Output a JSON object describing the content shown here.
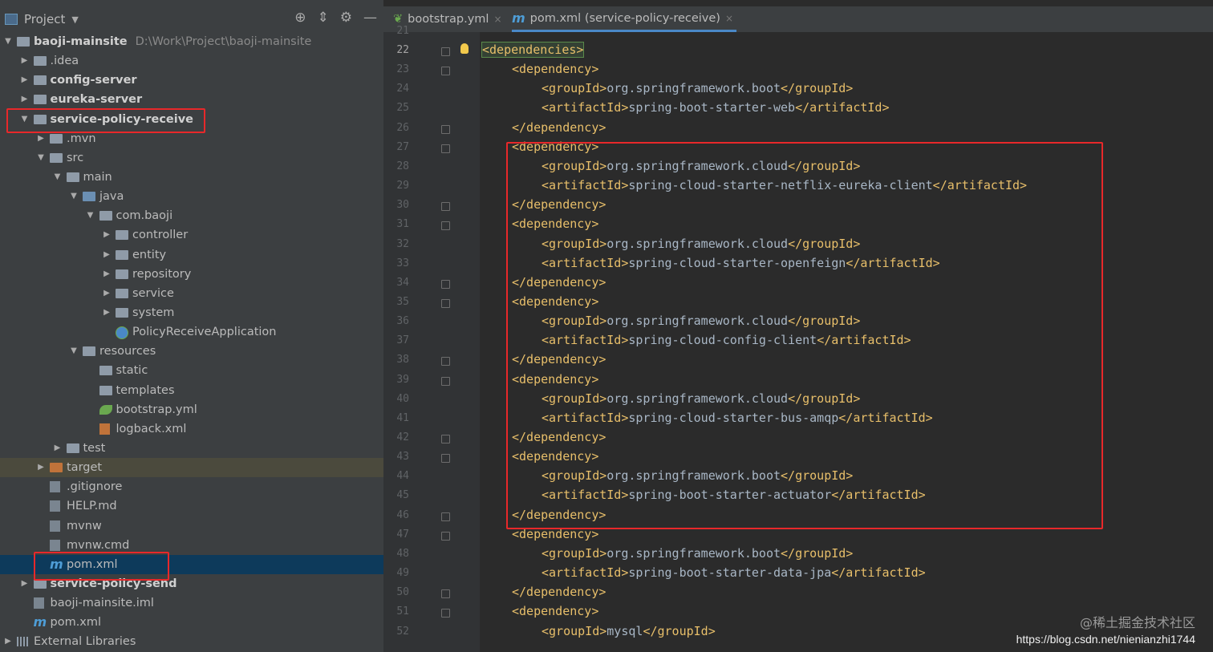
{
  "project_pane": {
    "title": "Project",
    "tool_icons": [
      "globe-icon",
      "collapse-icon",
      "gear-icon",
      "minimize-icon"
    ]
  },
  "tree": [
    {
      "label": "baoji-mainsite",
      "path": "D:\\Work\\Project\\baoji-mainsite",
      "depth": 0,
      "arrow": "down",
      "icon": "folder",
      "bold": true
    },
    {
      "label": ".idea",
      "depth": 1,
      "arrow": "right",
      "icon": "folder"
    },
    {
      "label": "config-server",
      "depth": 1,
      "arrow": "right",
      "icon": "folder",
      "bold": true
    },
    {
      "label": "eureka-server",
      "depth": 1,
      "arrow": "right",
      "icon": "folder",
      "bold": true
    },
    {
      "label": "service-policy-receive",
      "depth": 1,
      "arrow": "down",
      "icon": "folder",
      "bold": true
    },
    {
      "label": ".mvn",
      "depth": 2,
      "arrow": "right",
      "icon": "folder"
    },
    {
      "label": "src",
      "depth": 2,
      "arrow": "down",
      "icon": "folder"
    },
    {
      "label": "main",
      "depth": 3,
      "arrow": "down",
      "icon": "folder"
    },
    {
      "label": "java",
      "depth": 4,
      "arrow": "down",
      "icon": "folder-blue"
    },
    {
      "label": "com.baoji",
      "depth": 5,
      "arrow": "down",
      "icon": "folder"
    },
    {
      "label": "controller",
      "depth": 6,
      "arrow": "right",
      "icon": "folder"
    },
    {
      "label": "entity",
      "depth": 6,
      "arrow": "right",
      "icon": "folder"
    },
    {
      "label": "repository",
      "depth": 6,
      "arrow": "right",
      "icon": "folder"
    },
    {
      "label": "service",
      "depth": 6,
      "arrow": "right",
      "icon": "folder"
    },
    {
      "label": "system",
      "depth": 6,
      "arrow": "right",
      "icon": "folder"
    },
    {
      "label": "PolicyReceiveApplication",
      "depth": 6,
      "arrow": "",
      "icon": "spring-class"
    },
    {
      "label": "resources",
      "depth": 4,
      "arrow": "down",
      "icon": "folder"
    },
    {
      "label": "static",
      "depth": 5,
      "arrow": "",
      "icon": "folder"
    },
    {
      "label": "templates",
      "depth": 5,
      "arrow": "",
      "icon": "folder"
    },
    {
      "label": "bootstrap.yml",
      "depth": 5,
      "arrow": "",
      "icon": "yml-leaf"
    },
    {
      "label": "logback.xml",
      "depth": 5,
      "arrow": "",
      "icon": "xml-file"
    },
    {
      "label": "test",
      "depth": 3,
      "arrow": "right",
      "icon": "folder"
    },
    {
      "label": "target",
      "depth": 2,
      "arrow": "right",
      "icon": "folder-orange",
      "highlight": "olive"
    },
    {
      "label": ".gitignore",
      "depth": 2,
      "arrow": "",
      "icon": "file"
    },
    {
      "label": "HELP.md",
      "depth": 2,
      "arrow": "",
      "icon": "md-file"
    },
    {
      "label": "mvnw",
      "depth": 2,
      "arrow": "",
      "icon": "file"
    },
    {
      "label": "mvnw.cmd",
      "depth": 2,
      "arrow": "",
      "icon": "file"
    },
    {
      "label": "pom.xml",
      "depth": 2,
      "arrow": "",
      "icon": "maven",
      "highlight": "selected"
    },
    {
      "label": "service-policy-send",
      "depth": 1,
      "arrow": "right",
      "icon": "folder",
      "bold": true
    },
    {
      "label": "baoji-mainsite.iml",
      "depth": 1,
      "arrow": "",
      "icon": "file"
    },
    {
      "label": "pom.xml",
      "depth": 1,
      "arrow": "",
      "icon": "maven"
    },
    {
      "label": "External Libraries",
      "depth": 0,
      "arrow": "right",
      "icon": "library"
    }
  ],
  "tabs": [
    {
      "label": "bootstrap.yml",
      "icon": "yml-leaf",
      "active": false
    },
    {
      "label": "pom.xml (service-policy-receive)",
      "icon": "maven",
      "active": true
    }
  ],
  "editor": {
    "first_partial_line": "21",
    "lines": [
      {
        "n": "22",
        "indent": 0,
        "parts": [
          {
            "t": "<dependencies>"
          }
        ],
        "current": true,
        "fold": "open",
        "bulb": true
      },
      {
        "n": "23",
        "indent": 1,
        "parts": [
          {
            "t": "<dependency>"
          }
        ],
        "fold": "open"
      },
      {
        "n": "24",
        "indent": 2,
        "parts": [
          {
            "t": "<groupId>"
          },
          {
            "v": "org.springframework.boot"
          },
          {
            "t": "</groupId>"
          }
        ]
      },
      {
        "n": "25",
        "indent": 2,
        "parts": [
          {
            "t": "<artifactId>"
          },
          {
            "v": "spring-boot-starter-web"
          },
          {
            "t": "</artifactId>"
          }
        ]
      },
      {
        "n": "26",
        "indent": 1,
        "parts": [
          {
            "t": "</dependency>"
          }
        ],
        "fold": "close"
      },
      {
        "n": "27",
        "indent": 1,
        "parts": [
          {
            "t": "<dependency>"
          }
        ],
        "fold": "open"
      },
      {
        "n": "28",
        "indent": 2,
        "parts": [
          {
            "t": "<groupId>"
          },
          {
            "v": "org.springframework.cloud"
          },
          {
            "t": "</groupId>"
          }
        ]
      },
      {
        "n": "29",
        "indent": 2,
        "parts": [
          {
            "t": "<artifactId>"
          },
          {
            "v": "spring-cloud-starter-netflix-eureka-client"
          },
          {
            "t": "</artifactId>"
          }
        ]
      },
      {
        "n": "30",
        "indent": 1,
        "parts": [
          {
            "t": "</dependency>"
          }
        ],
        "fold": "close"
      },
      {
        "n": "31",
        "indent": 1,
        "parts": [
          {
            "t": "<dependency>"
          }
        ],
        "fold": "open"
      },
      {
        "n": "32",
        "indent": 2,
        "parts": [
          {
            "t": "<groupId>"
          },
          {
            "v": "org.springframework.cloud"
          },
          {
            "t": "</groupId>"
          }
        ]
      },
      {
        "n": "33",
        "indent": 2,
        "parts": [
          {
            "t": "<artifactId>"
          },
          {
            "v": "spring-cloud-starter-openfeign"
          },
          {
            "t": "</artifactId>"
          }
        ]
      },
      {
        "n": "34",
        "indent": 1,
        "parts": [
          {
            "t": "</dependency>"
          }
        ],
        "fold": "close"
      },
      {
        "n": "35",
        "indent": 1,
        "parts": [
          {
            "t": "<dependency>"
          }
        ],
        "fold": "open"
      },
      {
        "n": "36",
        "indent": 2,
        "parts": [
          {
            "t": "<groupId>"
          },
          {
            "v": "org.springframework.cloud"
          },
          {
            "t": "</groupId>"
          }
        ]
      },
      {
        "n": "37",
        "indent": 2,
        "parts": [
          {
            "t": "<artifactId>"
          },
          {
            "v": "spring-cloud-config-client"
          },
          {
            "t": "</artifactId>"
          }
        ]
      },
      {
        "n": "38",
        "indent": 1,
        "parts": [
          {
            "t": "</dependency>"
          }
        ],
        "fold": "close"
      },
      {
        "n": "39",
        "indent": 1,
        "parts": [
          {
            "t": "<dependency>"
          }
        ],
        "fold": "open"
      },
      {
        "n": "40",
        "indent": 2,
        "parts": [
          {
            "t": "<groupId>"
          },
          {
            "v": "org.springframework.cloud"
          },
          {
            "t": "</groupId>"
          }
        ]
      },
      {
        "n": "41",
        "indent": 2,
        "parts": [
          {
            "t": "<artifactId>"
          },
          {
            "v": "spring-cloud-starter-bus-amqp"
          },
          {
            "t": "</artifactId>"
          }
        ]
      },
      {
        "n": "42",
        "indent": 1,
        "parts": [
          {
            "t": "</dependency>"
          }
        ],
        "fold": "close"
      },
      {
        "n": "43",
        "indent": 1,
        "parts": [
          {
            "t": "<dependency>"
          }
        ],
        "fold": "open"
      },
      {
        "n": "44",
        "indent": 2,
        "parts": [
          {
            "t": "<groupId>"
          },
          {
            "v": "org.springframework.boot"
          },
          {
            "t": "</groupId>"
          }
        ]
      },
      {
        "n": "45",
        "indent": 2,
        "parts": [
          {
            "t": "<artifactId>"
          },
          {
            "v": "spring-boot-starter-actuator"
          },
          {
            "t": "</artifactId>"
          }
        ]
      },
      {
        "n": "46",
        "indent": 1,
        "parts": [
          {
            "t": "</dependency>"
          }
        ],
        "fold": "close"
      },
      {
        "n": "47",
        "indent": 1,
        "parts": [
          {
            "t": "<dependency>"
          }
        ],
        "fold": "open"
      },
      {
        "n": "48",
        "indent": 2,
        "parts": [
          {
            "t": "<groupId>"
          },
          {
            "v": "org.springframework.boot"
          },
          {
            "t": "</groupId>"
          }
        ]
      },
      {
        "n": "49",
        "indent": 2,
        "parts": [
          {
            "t": "<artifactId>"
          },
          {
            "v": "spring-boot-starter-data-jpa"
          },
          {
            "t": "</artifactId>"
          }
        ]
      },
      {
        "n": "50",
        "indent": 1,
        "parts": [
          {
            "t": "</dependency>"
          }
        ],
        "fold": "close"
      },
      {
        "n": "51",
        "indent": 1,
        "parts": [
          {
            "t": "<dependency>"
          }
        ],
        "fold": "open"
      },
      {
        "n": "52",
        "indent": 2,
        "parts": [
          {
            "t": "<groupId>"
          },
          {
            "v": "mysql"
          },
          {
            "t": "</groupId>"
          }
        ]
      }
    ]
  },
  "watermark": {
    "brand": "@稀土掘金技术社区",
    "url": "https://blog.csdn.net/nienianzhi1744"
  },
  "colors": {
    "annotation_red": "#e8282a",
    "xml_tag": "#e8bf6a",
    "xml_text": "#a9b7c6",
    "selection": "#0d3a5b"
  }
}
